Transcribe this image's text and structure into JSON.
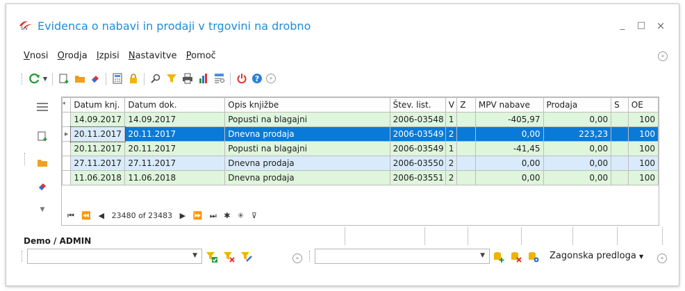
{
  "window": {
    "title": "Evidenca o nabavi in prodaji v trgovini na drobno",
    "minimize": "_",
    "maximize": "□",
    "close": "×"
  },
  "menu": [
    {
      "label": "Vnosi"
    },
    {
      "label": "Orodja"
    },
    {
      "label": "Izpisi"
    },
    {
      "label": "Nastavitve"
    },
    {
      "label": "Pomoč"
    }
  ],
  "toolbar": {
    "icons": [
      "refresh-icon",
      "new-document-icon",
      "open-folder-icon",
      "eraser-icon",
      "calculator-icon",
      "lock-icon",
      "search-icon",
      "filter-icon",
      "print-icon",
      "chart-icon",
      "report-icon",
      "power-icon",
      "help-icon",
      "expand-icon"
    ]
  },
  "grid": {
    "columns": [
      "*",
      "Datum knj.",
      "Datum dok.",
      "Opis knjižbe",
      "Štev. list.",
      "V",
      "Z",
      "MPV nabave",
      "Prodaja",
      "S",
      "OE"
    ],
    "rows": [
      {
        "datum_knj": "14.09.2017",
        "datum_dok": "14.09.2017",
        "opis": "Popusti na blagajni",
        "stev": "2006-03548",
        "v": "1",
        "z": "",
        "mpv": "-405,97",
        "prodaja": "0,00",
        "s": "",
        "oe": "100",
        "style": "green"
      },
      {
        "datum_knj": "20.11.2017",
        "datum_dok": "20.11.2017",
        "opis": "Dnevna prodaja",
        "stev": "2006-03549",
        "v": "2",
        "z": "",
        "mpv": "0,00",
        "prodaja": "223,23",
        "s": "",
        "oe": "100",
        "style": "selected"
      },
      {
        "datum_knj": "20.11.2017",
        "datum_dok": "20.11.2017",
        "opis": "Popusti na blagajni",
        "stev": "2006-03549",
        "v": "1",
        "z": "",
        "mpv": "-41,45",
        "prodaja": "0,00",
        "s": "",
        "oe": "100",
        "style": "green"
      },
      {
        "datum_knj": "27.11.2017",
        "datum_dok": "27.11.2017",
        "opis": "Dnevna prodaja",
        "stev": "2006-03550",
        "v": "2",
        "z": "",
        "mpv": "0,00",
        "prodaja": "0,00",
        "s": "",
        "oe": "100",
        "style": "blue"
      },
      {
        "datum_knj": "11.06.2018",
        "datum_dok": "11.06.2018",
        "opis": "Dnevna prodaja",
        "stev": "2006-03551",
        "v": "2",
        "z": "",
        "mpv": "0,00",
        "prodaja": "0,00",
        "s": "",
        "oe": "100",
        "style": "green"
      }
    ],
    "navigator": {
      "record_text": "23480 of 23483",
      "buttons": [
        "⏮",
        "⏪",
        "◀",
        "▶",
        "⏩",
        "⏭",
        "✱",
        "✳",
        "⊽"
      ]
    }
  },
  "status": {
    "user": "Demo / ADMIN"
  },
  "bottom": {
    "left_combo_value": "",
    "right_combo_value": "",
    "template_label": "Zagonska predloga"
  },
  "colors": {
    "title": "#1f8dd6",
    "row_green": "#dff5dc",
    "row_blue": "#d9ebfa",
    "row_selected": "#0a7ad8",
    "grid_border": "#bdbdbd"
  }
}
